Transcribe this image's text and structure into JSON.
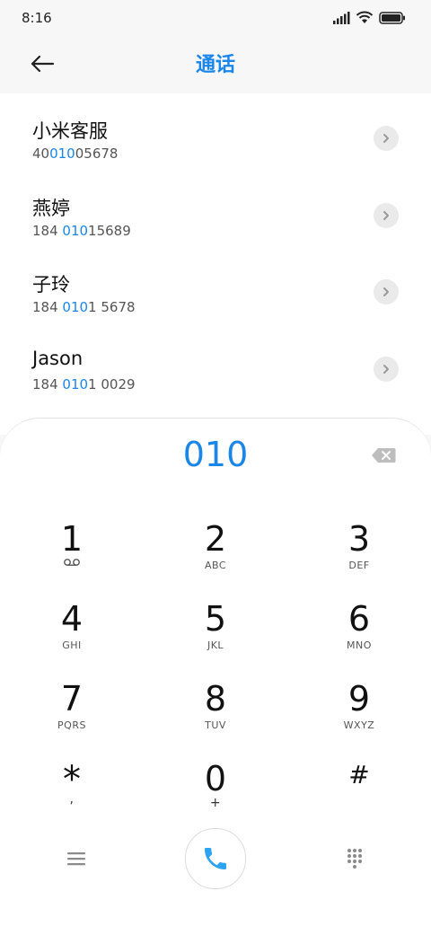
{
  "status_bar": {
    "time": "8:16"
  },
  "header": {
    "title": "通话",
    "back_icon": "arrow-left-icon"
  },
  "contacts": [
    {
      "name": "小米客服",
      "number_pre": "40",
      "number_match": "010",
      "number_post": "05678"
    },
    {
      "name": "燕婷",
      "number_pre": "184 ",
      "number_match": "010",
      "number_post": "15689"
    },
    {
      "name": "子玲",
      "number_pre": "184 ",
      "number_match": "010",
      "number_post": "1 5678"
    },
    {
      "name": "Jason",
      "number_pre": "184 ",
      "number_match": "010",
      "number_post": "1 0029"
    }
  ],
  "dialpad": {
    "input": "010",
    "keys": [
      {
        "digit": "1",
        "sub": ""
      },
      {
        "digit": "2",
        "sub": "ABC"
      },
      {
        "digit": "3",
        "sub": "DEF"
      },
      {
        "digit": "4",
        "sub": "GHI"
      },
      {
        "digit": "5",
        "sub": "JKL"
      },
      {
        "digit": "6",
        "sub": "MNO"
      },
      {
        "digit": "7",
        "sub": "PQRS"
      },
      {
        "digit": "8",
        "sub": "TUV"
      },
      {
        "digit": "9",
        "sub": "WXYZ"
      },
      {
        "digit": "*",
        "sub": ","
      },
      {
        "digit": "0",
        "sub": "+"
      },
      {
        "digit": "#",
        "sub": ""
      }
    ]
  },
  "colors": {
    "accent": "#1a86ea",
    "call_icon": "#2ea3f2"
  }
}
